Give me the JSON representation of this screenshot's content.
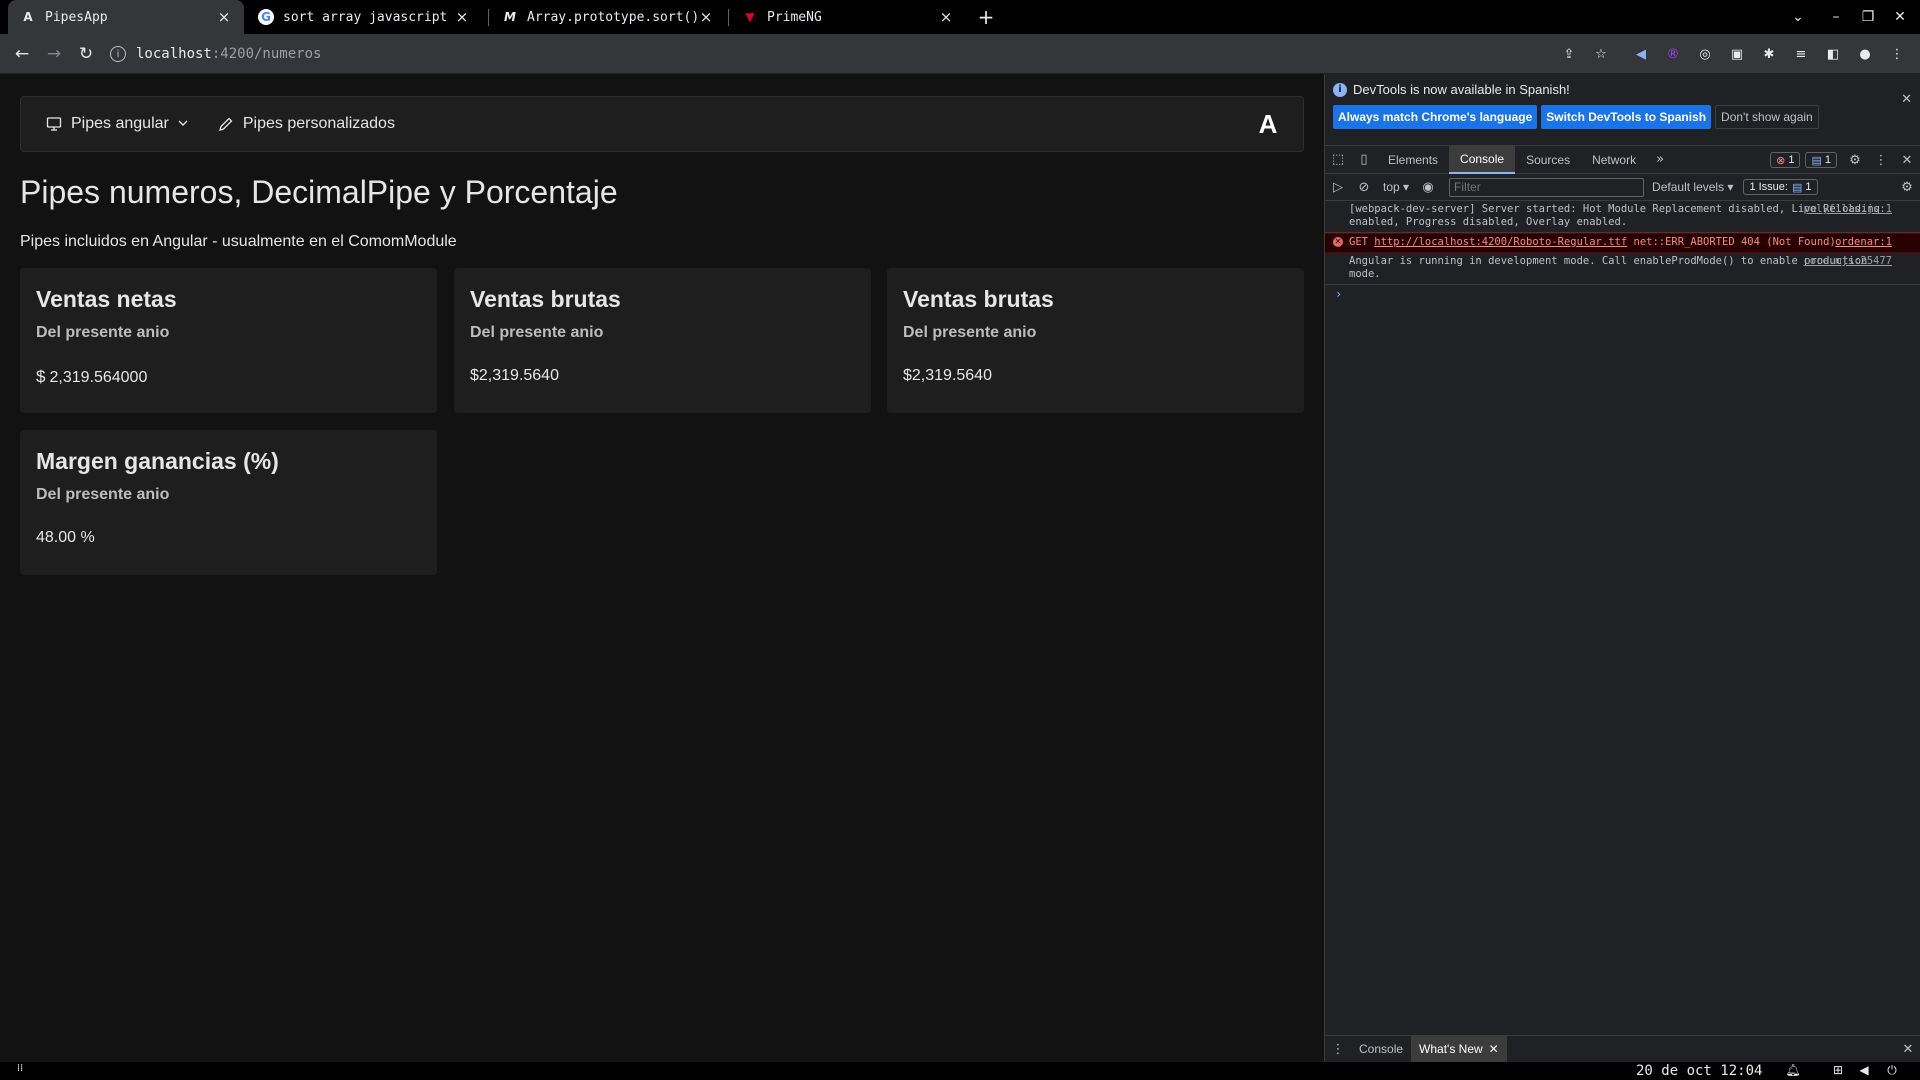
{
  "browser": {
    "tabs": [
      {
        "title": "PipesApp",
        "favicon": "A"
      },
      {
        "title": "sort array javascript",
        "favicon": "G"
      },
      {
        "title": "Array.prototype.sort()",
        "favicon": "M"
      },
      {
        "title": "PrimeNG",
        "favicon": "▼"
      }
    ],
    "new_tab": "+",
    "url_host": "localhost",
    "url_path": ":4200/numeros"
  },
  "app": {
    "menu": [
      {
        "label": "Pipes angular",
        "icon": "monitor-icon",
        "dropdown": true
      },
      {
        "label": "Pipes personalizados",
        "icon": "pencil-icon",
        "dropdown": false
      }
    ],
    "logo": "A",
    "title": "Pipes numeros, DecimalPipe y Porcentaje",
    "subtitle": "Pipes incluidos en Angular - usualmente en el ComomModule",
    "cards": [
      {
        "title": "Ventas netas",
        "subtitle": "Del presente anio",
        "value": "2,319.564000",
        "currency_icon": "$"
      },
      {
        "title": "Ventas brutas",
        "subtitle": "Del presente anio",
        "value": "$2,319.5640"
      },
      {
        "title": "Ventas brutas",
        "subtitle": "Del presente anio",
        "value": "$2,319.5640"
      },
      {
        "title": "Margen ganancias (%)",
        "subtitle": "Del presente anio",
        "value": "48.00 %"
      }
    ]
  },
  "devtools": {
    "info_message": "DevTools is now available in Spanish!",
    "info_buttons": [
      "Always match Chrome's language",
      "Switch DevTools to Spanish",
      "Don't show again"
    ],
    "tabs": [
      "Elements",
      "Console",
      "Sources",
      "Network"
    ],
    "active_tab": "Console",
    "more_tabs": "»",
    "error_count": "1",
    "message_count": "1",
    "issues_label": "1 Issue:",
    "issues_count": "1",
    "context": "top",
    "filter_placeholder": "Filter",
    "levels": "Default levels",
    "logs": [
      {
        "type": "info",
        "text": "[webpack-dev-server] Server started: Hot Module Replacement disabled, Live Reloading enabled, Progress disabled, Overlay enabled.",
        "source": "polyfills.js:1"
      },
      {
        "type": "error",
        "prefix": "GET ",
        "link": "http://localhost:4200/Roboto-Regular.ttf",
        "text": " net::ERR_ABORTED 404 (Not Found)",
        "source": "ordenar:1"
      },
      {
        "type": "info",
        "text": "Angular is running in development mode. Call enableProdMode() to enable production mode.",
        "source": "core.mjs:25477"
      }
    ],
    "prompt": "›",
    "drawer_tabs": [
      "Console",
      "What's New"
    ]
  },
  "os": {
    "clock": "20 de oct 12:04"
  },
  "colors": {
    "page_bg": "#121212",
    "card_bg": "#1e1e1e",
    "devtools_accent": "#1a73e8",
    "error_red": "#f28b82"
  }
}
